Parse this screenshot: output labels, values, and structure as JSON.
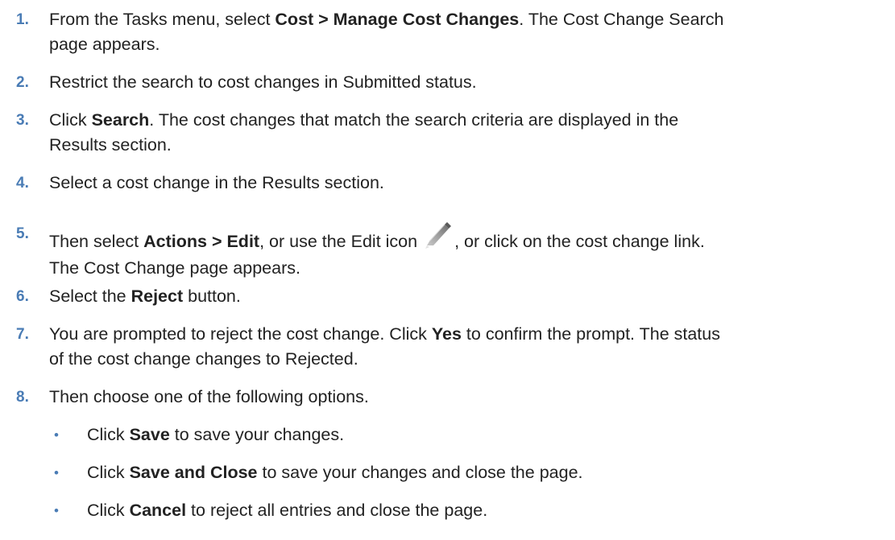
{
  "steps": [
    {
      "number": "1.",
      "parts": [
        "From the Tasks menu, select ",
        "Cost > Manage Cost Changes",
        ". The Cost Change Search",
        "page appears."
      ]
    },
    {
      "number": "2.",
      "text": "Restrict the search to cost changes in Submitted status."
    },
    {
      "number": "3.",
      "parts": [
        "Click ",
        "Search",
        ". The cost changes that match the search criteria are displayed in the",
        "Results section."
      ]
    },
    {
      "number": "4.",
      "text": "Select a cost change in the Results section."
    },
    {
      "number": "5.",
      "parts": [
        "Then select ",
        "Actions > Edit",
        ", or use the Edit icon",
        ", or click on the cost change link.",
        "The Cost Change page appears."
      ]
    },
    {
      "number": "6.",
      "parts": [
        "Select the ",
        "Reject",
        " button."
      ]
    },
    {
      "number": "7.",
      "parts": [
        "You are prompted to reject the cost change. Click ",
        "Yes",
        " to confirm the prompt. The status",
        "of the cost change changes to Rejected."
      ]
    },
    {
      "number": "8.",
      "text": "Then choose one of the following options."
    }
  ],
  "options": [
    {
      "bullet": "•",
      "parts": [
        "Click ",
        "Save",
        " to save your changes."
      ]
    },
    {
      "bullet": "•",
      "parts": [
        "Click ",
        "Save and Close",
        " to save your changes and close the page."
      ]
    },
    {
      "bullet": "•",
      "parts": [
        "Click ",
        "Cancel",
        " to reject all entries and close the page."
      ]
    }
  ],
  "icons": {
    "edit": "pencil-icon"
  }
}
